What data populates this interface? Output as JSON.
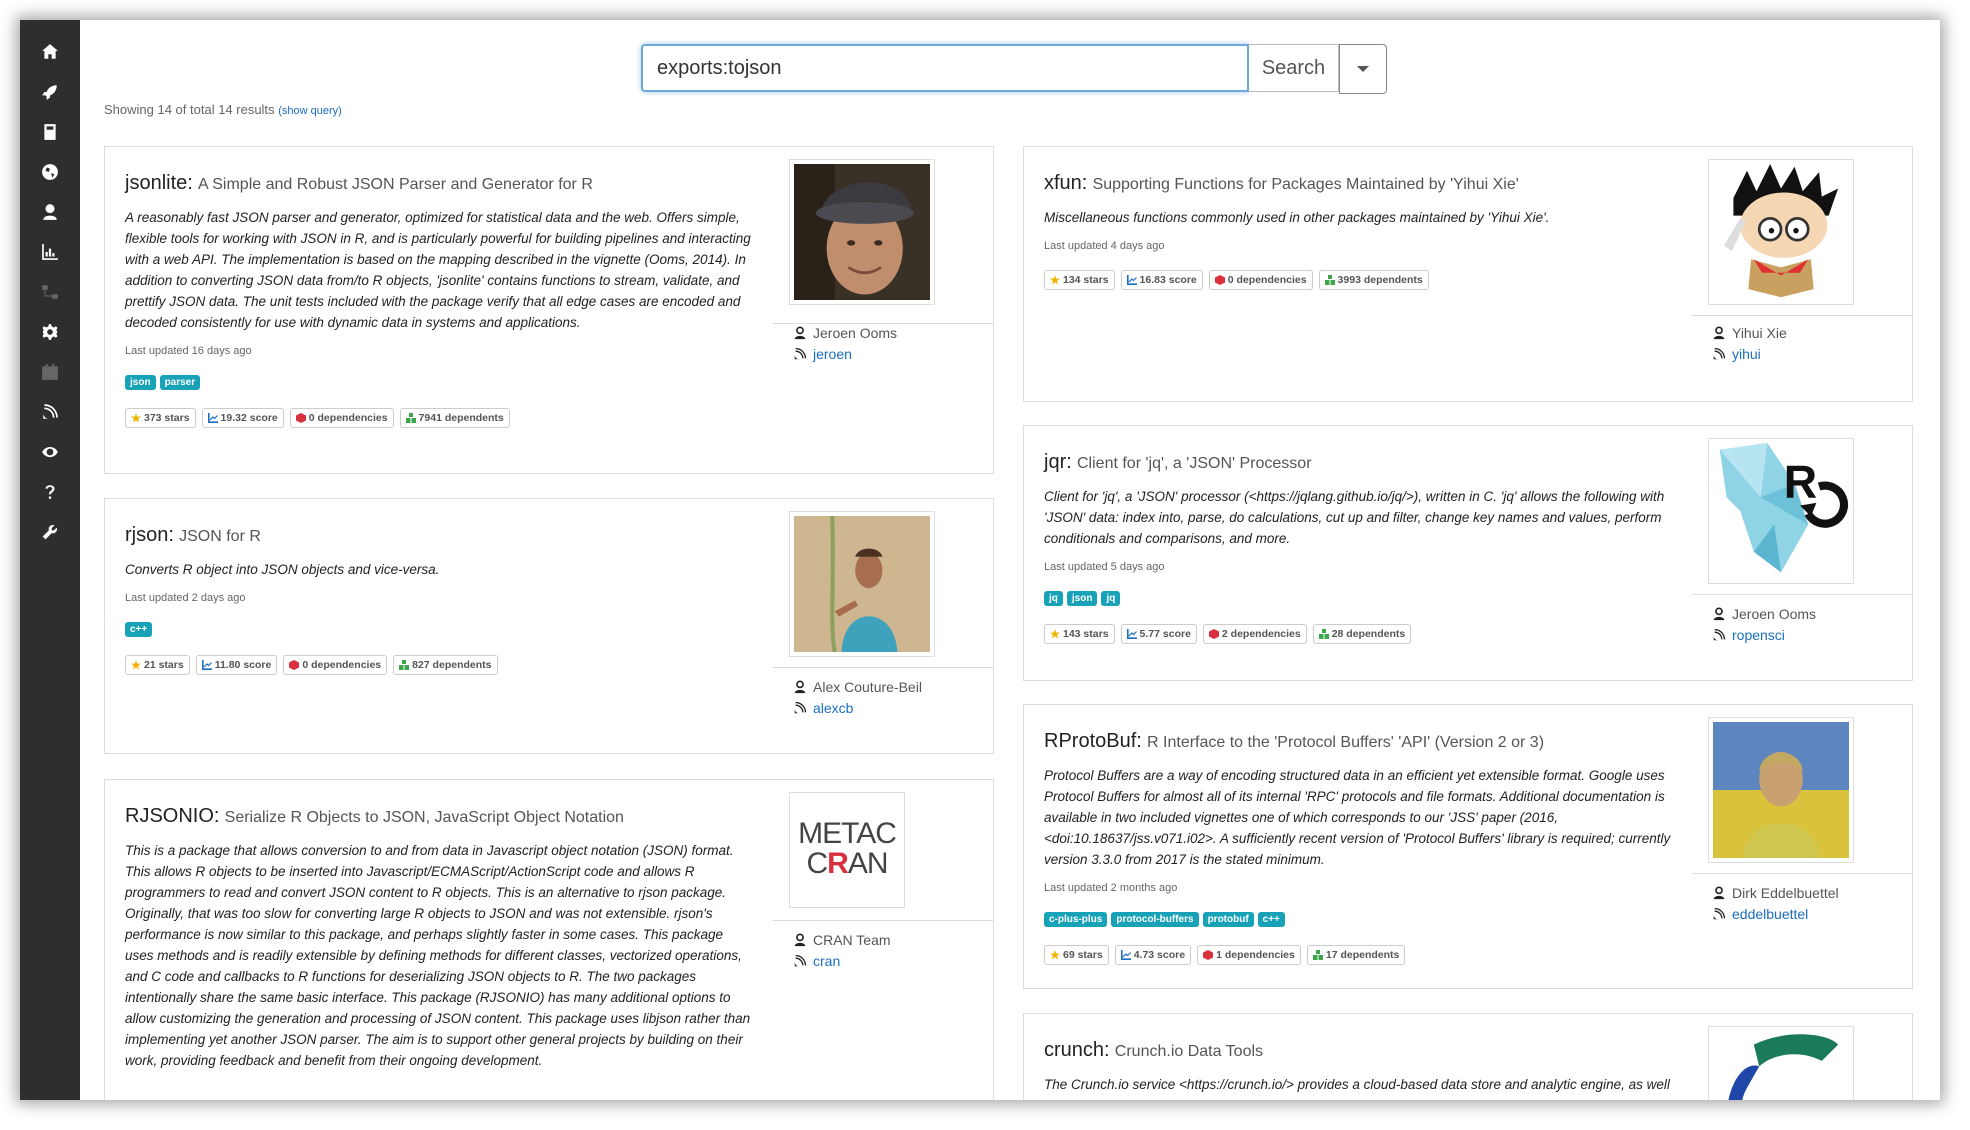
{
  "search": {
    "value": "exports:tojson",
    "button_label": "Search"
  },
  "result_count": {
    "text": "Showing 14 of total 14 results",
    "link": "(show query)"
  },
  "sidebar": {
    "items": [
      {
        "icon": "home-icon"
      },
      {
        "icon": "rocket-icon"
      },
      {
        "icon": "book-icon"
      },
      {
        "icon": "globe-icon"
      },
      {
        "icon": "user-icon"
      },
      {
        "icon": "bar-chart-icon"
      },
      {
        "icon": "network-icon"
      },
      {
        "icon": "gear-icon"
      },
      {
        "icon": "calendar-icon"
      },
      {
        "icon": "satellite-icon"
      },
      {
        "icon": "eye-icon"
      },
      {
        "icon": "question-icon"
      },
      {
        "icon": "wrench-icon"
      }
    ]
  },
  "packages": [
    {
      "name": "jsonlite:",
      "title": "A Simple and Robust JSON Parser and Generator for R",
      "description": "A reasonably fast JSON parser and generator, optimized for statistical data and the web. Offers simple, flexible tools for working with JSON in R, and is particularly powerful for building pipelines and interacting with a web API. The implementation is based on the mapping described in the vignette (Ooms, 2014). In addition to converting JSON data from/to R objects, 'jsonlite' contains functions to stream, validate, and prettify JSON data. The unit tests included with the package verify that all edge cases are encoded and decoded consistently for use with dynamic data in systems and applications.",
      "updated": "Last updated 16 days ago",
      "tags": [
        "json",
        "parser"
      ],
      "stats": {
        "stars": "373 stars",
        "score": "19.32 score",
        "deps": "0 dependencies",
        "dependents": "7941 dependents"
      },
      "maintainer": "Jeroen Ooms",
      "universe": "jeroen"
    },
    {
      "name": "rjson:",
      "title": "JSON for R",
      "description": "Converts R object into JSON objects and vice-versa.",
      "updated": "Last updated 2 days ago",
      "tags": [
        "c++"
      ],
      "stats": {
        "stars": "21 stars",
        "score": "11.80 score",
        "deps": "0 dependencies",
        "dependents": "827 dependents"
      },
      "maintainer": "Alex Couture-Beil",
      "universe": "alexcb"
    },
    {
      "name": "RJSONIO:",
      "title": "Serialize R Objects to JSON, JavaScript Object Notation",
      "description": "This is a package that allows conversion to and from data in Javascript object notation (JSON) format. This allows R objects to be inserted into Javascript/ECMAScript/ActionScript code and allows R programmers to read and convert JSON content to R objects. This is an alternative to rjson package. Originally, that was too slow for converting large R objects to JSON and was not extensible. rjson's performance is now similar to this package, and perhaps slightly faster in some cases. This package uses methods and is readily extensible by defining methods for different classes, vectorized operations, and C code and callbacks to R functions for deserializing JSON objects to R. The two packages intentionally share the same basic interface. This package (RJSONIO) has many additional options to allow customizing the generation and processing of JSON content. This package uses libjson rather than implementing yet another JSON parser. The aim is to support other general projects by building on their work, providing feedback and benefit from their ongoing development.",
      "maintainer": "CRAN Team",
      "universe": "cran",
      "logo_top": "METAC",
      "logo_bot_1": "C",
      "logo_bot_r": "R",
      "logo_bot_2": "AN"
    },
    {
      "name": "xfun:",
      "title": "Supporting Functions for Packages Maintained by 'Yihui Xie'",
      "description": "Miscellaneous functions commonly used in other packages maintained by 'Yihui Xie'.",
      "updated": "Last updated 4 days ago",
      "stats": {
        "stars": "134 stars",
        "score": "16.83 score",
        "deps": "0 dependencies",
        "dependents": "3993 dependents"
      },
      "maintainer": "Yihui Xie",
      "universe": "yihui"
    },
    {
      "name": "jqr:",
      "title": "Client for 'jq', a 'JSON' Processor",
      "description": "Client for 'jq', a 'JSON' processor (<https://jqlang.github.io/jq/>), written in C. 'jq' allows the following with 'JSON' data: index into, parse, do calculations, cut up and filter, change key names and values, perform conditionals and comparisons, and more.",
      "updated": "Last updated 5 days ago",
      "tags": [
        "jq",
        "json",
        "jq"
      ],
      "stats": {
        "stars": "143 stars",
        "score": "5.77 score",
        "deps": "2 dependencies",
        "dependents": "28 dependents"
      },
      "maintainer": "Jeroen Ooms",
      "universe": "ropensci"
    },
    {
      "name": "RProtoBuf:",
      "title": "R Interface to the 'Protocol Buffers' 'API' (Version 2 or 3)",
      "description": "Protocol Buffers are a way of encoding structured data in an efficient yet extensible format. Google uses Protocol Buffers for almost all of its internal 'RPC' protocols and file formats. Additional documentation is available in two included vignettes one of which corresponds to our 'JSS' paper (2016, <doi:10.18637/jss.v071.i02>. A sufficiently recent version of 'Protocol Buffers' library is required; currently version 3.3.0 from 2017 is the stated minimum.",
      "updated": "Last updated 2 months ago",
      "tags": [
        "c-plus-plus",
        "protocol-buffers",
        "protobuf",
        "c++"
      ],
      "stats": {
        "stars": "69 stars",
        "score": "4.73 score",
        "deps": "1 dependencies",
        "dependents": "17 dependents"
      },
      "maintainer": "Dirk Eddelbuettel",
      "universe": "eddelbuettel"
    },
    {
      "name": "crunch:",
      "title": "Crunch.io Data Tools",
      "description": "The Crunch.io service <https://crunch.io/> provides a cloud-based data store and analytic engine, as well as an intuitive web interface. Using this package, analysts can interact with and manipulate"
    }
  ],
  "colors": {
    "sidebar": "#2d2e30",
    "tag": "#17a2b8",
    "link": "#1a6fc0",
    "star": "#f0b400",
    "score": "#1a6fc0",
    "deps": "#d9303e",
    "dependents": "#3da64a"
  }
}
